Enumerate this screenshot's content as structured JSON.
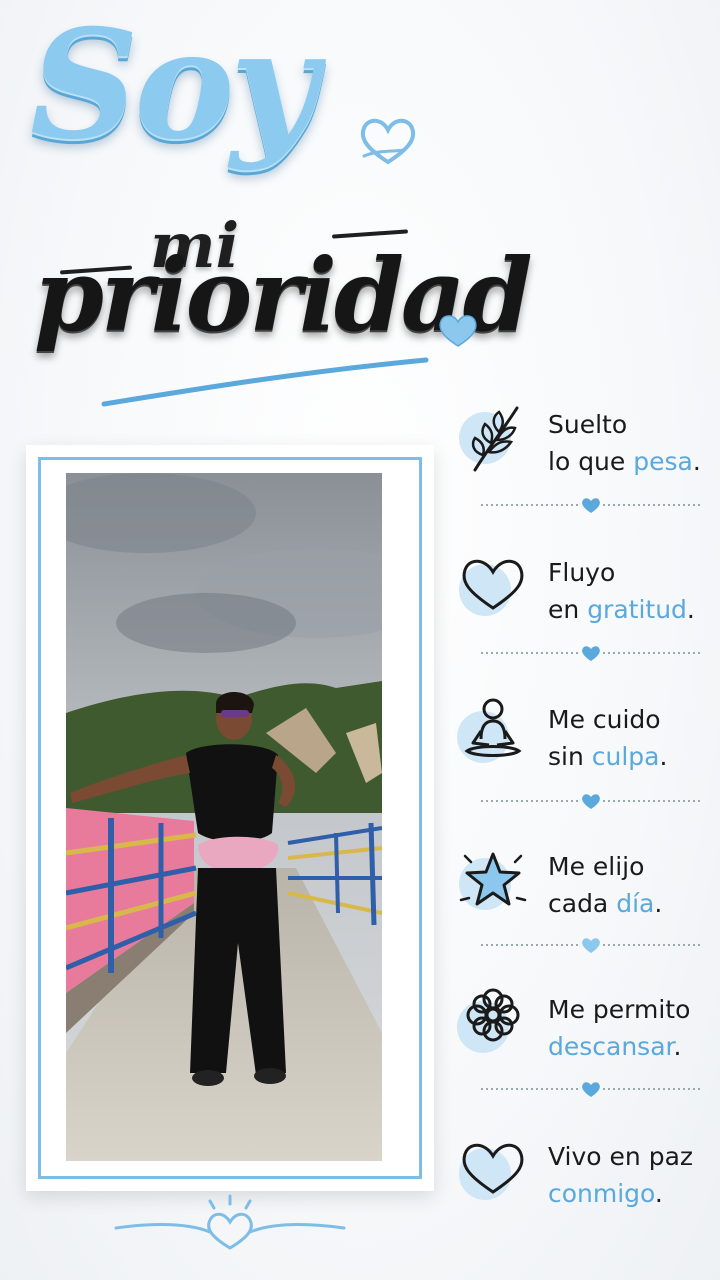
{
  "title": {
    "line1": "Soy",
    "line2": "mi",
    "line3": "prioridad"
  },
  "colors": {
    "accent_blue": "#7dbde6",
    "highlight_blue": "#5aa8dc",
    "dark": "#161616"
  },
  "affirmations": [
    {
      "icon": "leaf-icon",
      "line1": "Suelto",
      "line2_plain": "lo que ",
      "line2_highlight": "pesa",
      "line2_end": "."
    },
    {
      "icon": "heart-icon",
      "line1": "Fluyo",
      "line2_plain": "en ",
      "line2_highlight": "gratitud",
      "line2_end": "."
    },
    {
      "icon": "meditation-icon",
      "line1": "Me cuido",
      "line2_plain": "sin ",
      "line2_highlight": "culpa",
      "line2_end": "."
    },
    {
      "icon": "star-icon",
      "line1": "Me elijo",
      "line2_plain": "cada ",
      "line2_highlight": "día",
      "line2_end": "."
    },
    {
      "icon": "flower-icon",
      "line1": "Me permito",
      "line2_plain": "",
      "line2_highlight": "descansar",
      "line2_end": "."
    },
    {
      "icon": "heart-icon",
      "line1": "Vivo en paz",
      "line2_plain": "",
      "line2_highlight": "conmigo",
      "line2_end": "."
    }
  ]
}
